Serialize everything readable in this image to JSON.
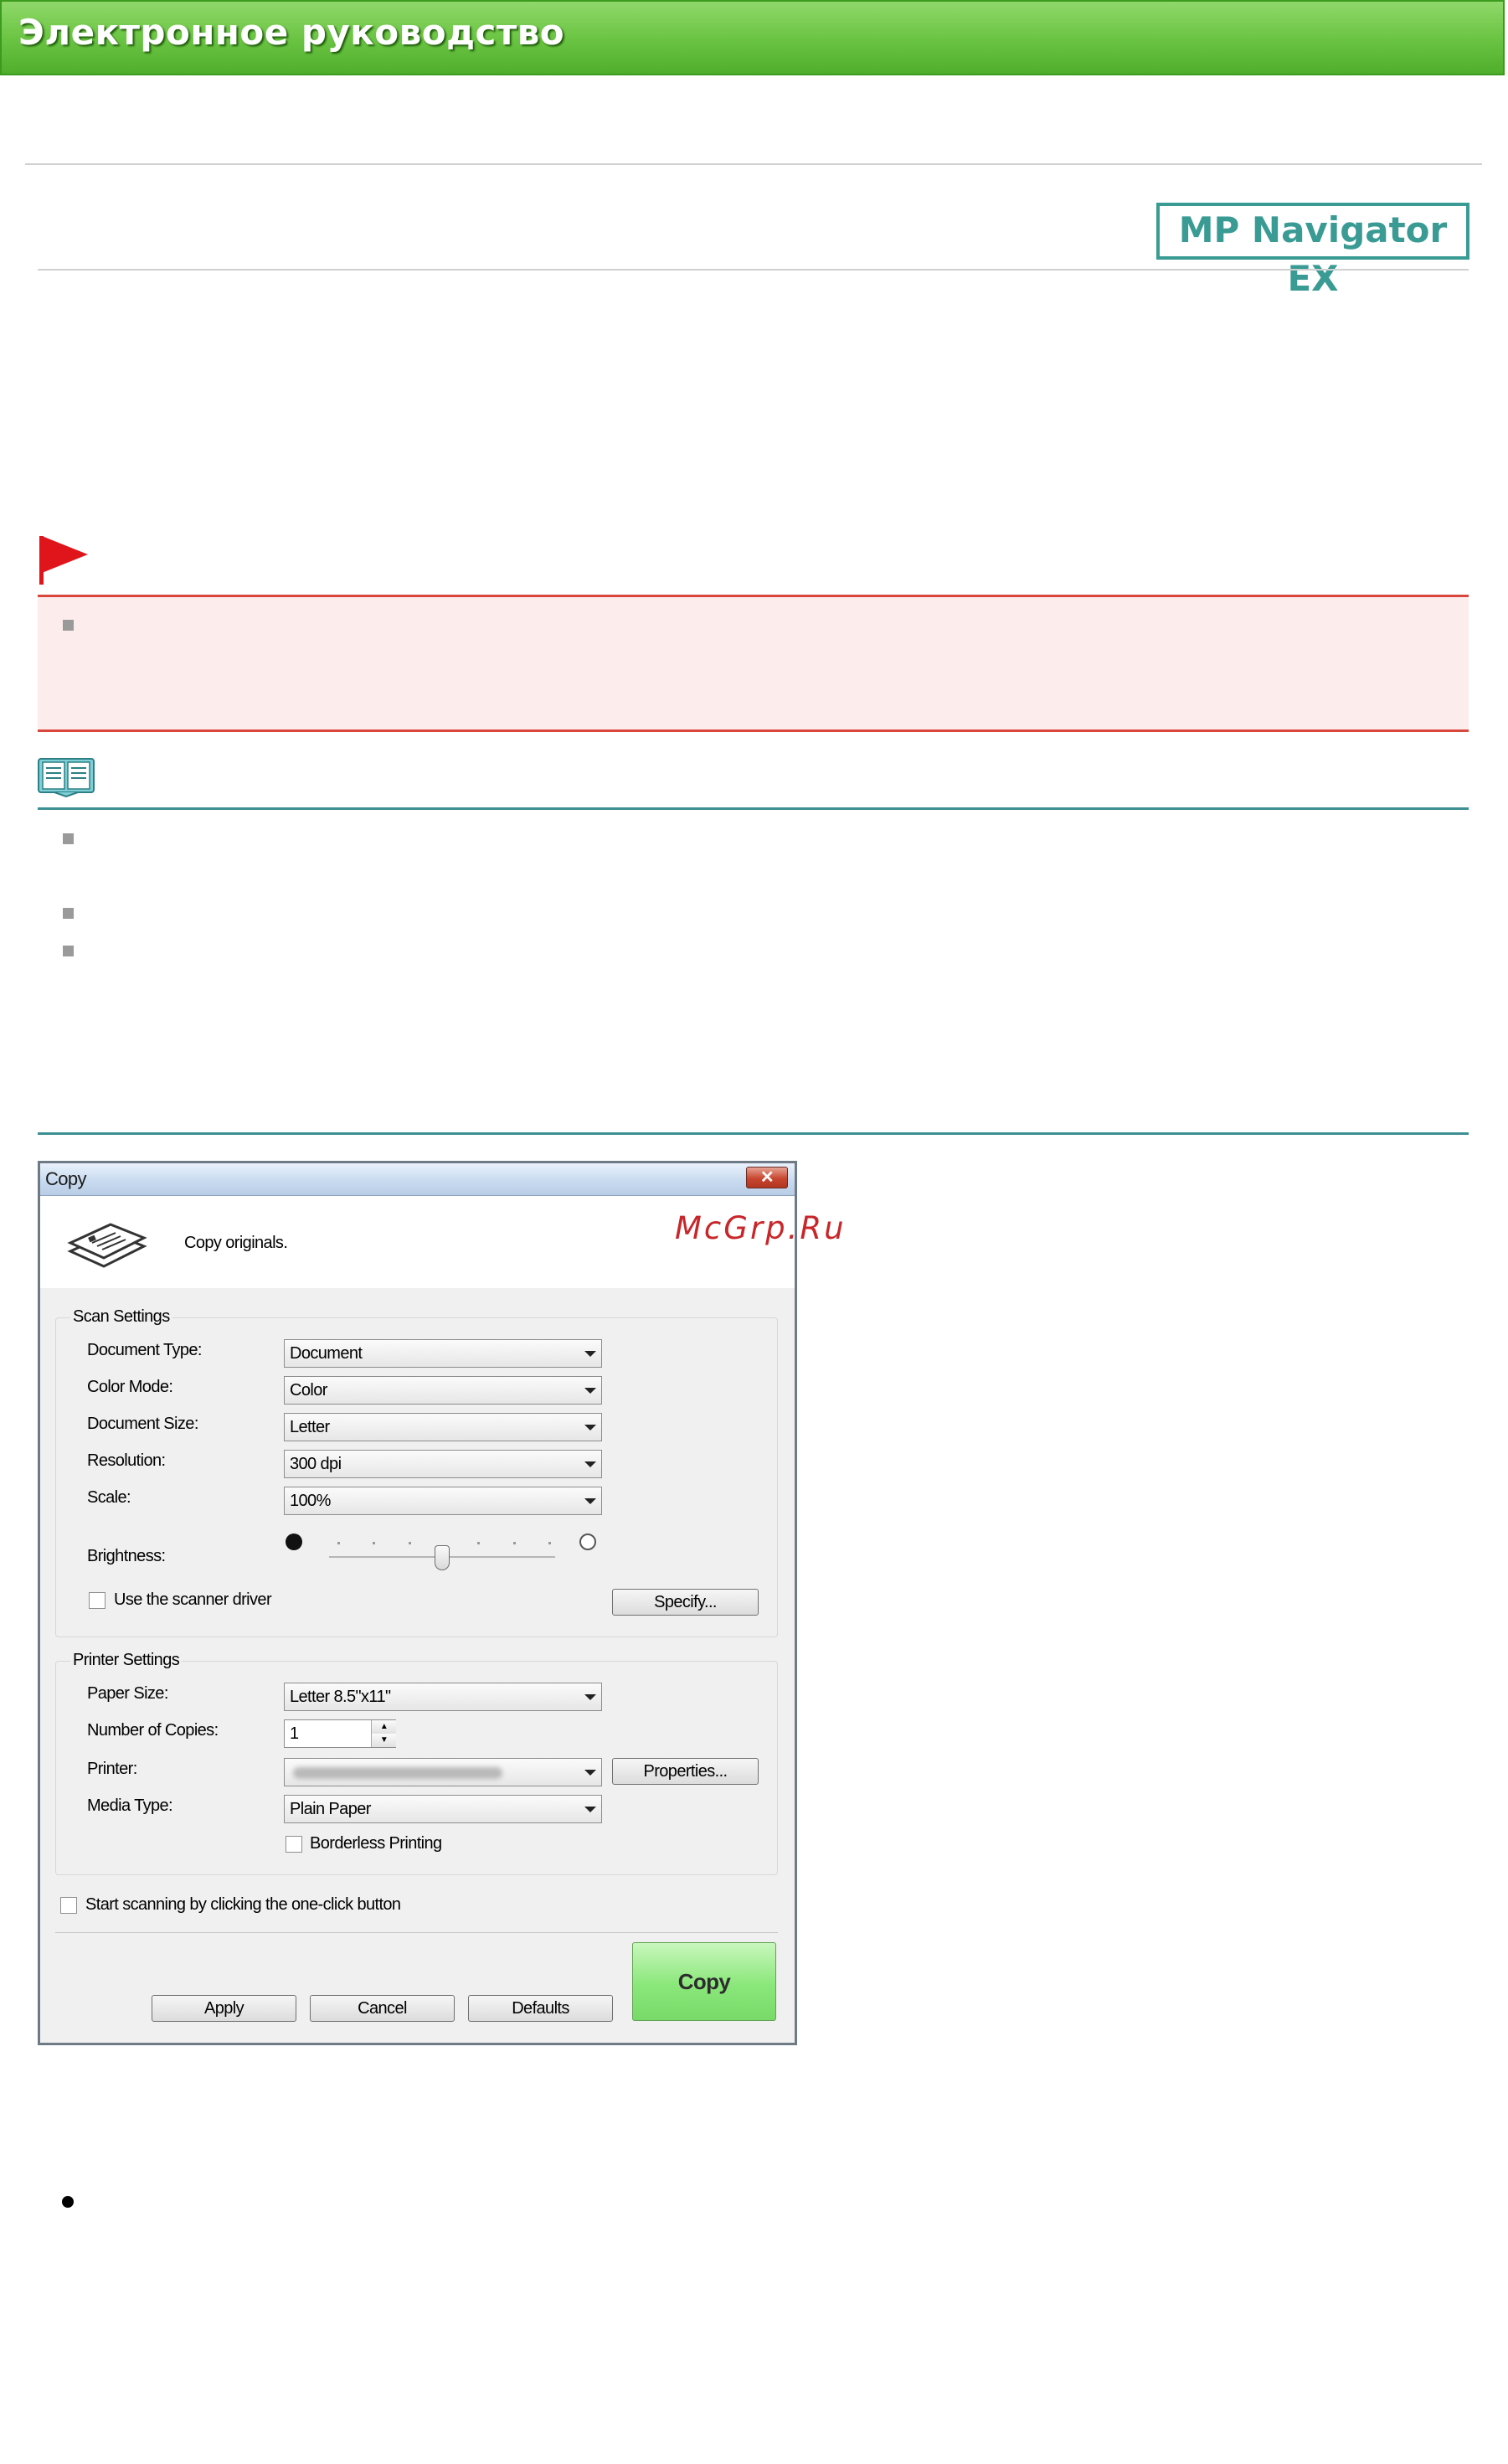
{
  "header": {
    "title": "Электронное руководство"
  },
  "logo": {
    "text": "MP Navigator EX"
  },
  "watermark": "McGrp.Ru",
  "dialog": {
    "title": "Copy",
    "description": "Copy originals.",
    "scan_settings": {
      "label": "Scan Settings",
      "document_type": {
        "label": "Document Type:",
        "value": "Document"
      },
      "color_mode": {
        "label": "Color Mode:",
        "value": "Color"
      },
      "document_size": {
        "label": "Document Size:",
        "value": "Letter"
      },
      "resolution": {
        "label": "Resolution:",
        "value": "300 dpi"
      },
      "scale": {
        "label": "Scale:",
        "value": "100%"
      },
      "brightness": {
        "label": "Brightness:",
        "level": 0.5
      },
      "use_driver": {
        "label": "Use the scanner driver",
        "checked": false
      },
      "specify_label": "Specify..."
    },
    "printer_settings": {
      "label": "Printer Settings",
      "paper_size": {
        "label": "Paper Size:",
        "value": "Letter 8.5\"x11\""
      },
      "copies": {
        "label": "Number of Copies:",
        "value": "1"
      },
      "printer": {
        "label": "Printer:"
      },
      "properties_label": "Properties...",
      "media_type": {
        "label": "Media Type:",
        "value": "Plain Paper"
      },
      "borderless": {
        "label": "Borderless Printing",
        "checked": false
      }
    },
    "one_click": {
      "label": "Start scanning by clicking the one-click button",
      "checked": false
    },
    "buttons": {
      "apply": "Apply",
      "cancel": "Cancel",
      "defaults": "Defaults",
      "copy": "Copy"
    }
  },
  "colors": {
    "banner": "#6cc544",
    "caution": "#d9463c",
    "note": "#3d8f93",
    "logo": "#3a9b94"
  }
}
